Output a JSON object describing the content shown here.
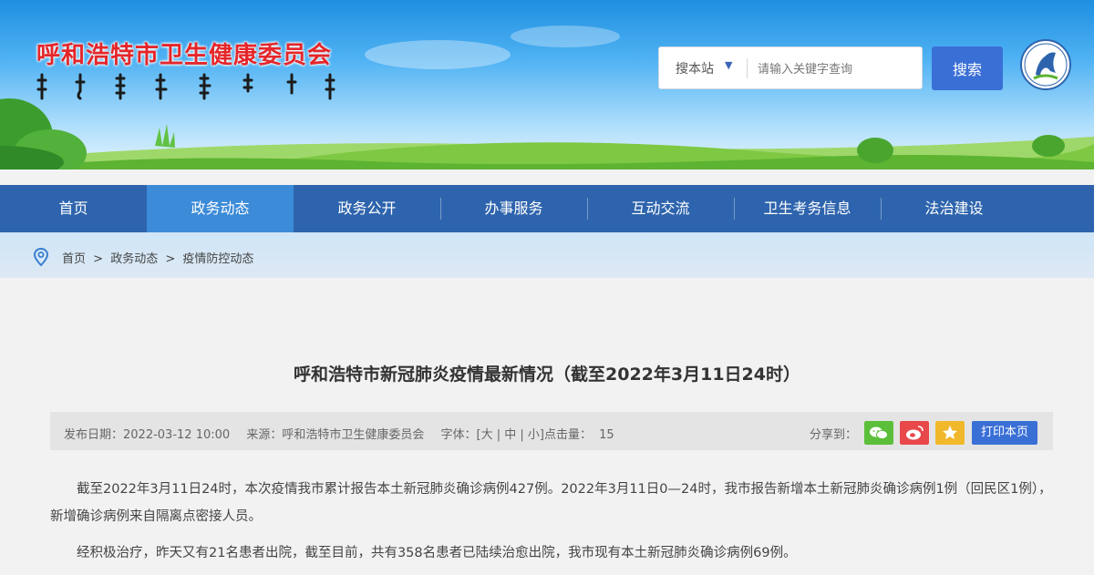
{
  "header": {
    "site_title": "呼和浩特市卫生健康委员会",
    "search_scope": "搜本站",
    "search_placeholder": "请输入关键字查询",
    "search_button": "搜索"
  },
  "nav": {
    "items": [
      "首页",
      "政务动态",
      "政务公开",
      "办事服务",
      "互动交流",
      "卫生考务信息",
      "法治建设"
    ],
    "active": "政务动态"
  },
  "breadcrumb": [
    "首页",
    ">",
    "政务动态",
    ">",
    "疫情防控动态"
  ],
  "article": {
    "title": "呼和浩特市新冠肺炎疫情最新情况（截至2022年3月11日24时）",
    "meta": {
      "date_label": "发布日期：",
      "date": "2022-03-12 10:00",
      "source_label": "来源：",
      "source": "呼和浩特市卫生健康委员会",
      "font_label": "字体：",
      "font_options": "[大 | 中 | 小]",
      "views_label": "点击量：",
      "views": "15",
      "share_label": "分享到：",
      "print": "打印本页"
    },
    "paragraphs": [
      "截至2022年3月11日24时，本次疫情我市累计报告本土新冠肺炎确诊病例427例。2022年3月11日0—24时，我市报告新增本土新冠肺炎确诊病例1例（回民区1例），新增确诊病例来自隔离点密接人员。",
      "经积极治疗，昨天又有21名患者出院，截至目前，共有358名患者已陆续治愈出院，我市现有本土新冠肺炎确诊病例69例。"
    ]
  },
  "colors": {
    "nav_bg": "#2e64ad",
    "nav_active": "#3b8bd8",
    "title_red": "#e4262a",
    "button_blue": "#3a6fd6",
    "wechat": "#5cbf3a",
    "weibo": "#e8484a",
    "qzone": "#f2b82b"
  }
}
